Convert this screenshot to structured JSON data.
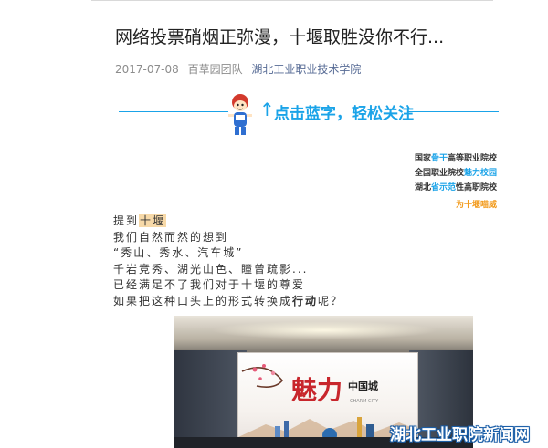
{
  "article": {
    "title": "网络投票硝烟正弥漫，十堰取胜没你不行...",
    "date": "2017-07-08",
    "author": "百草园团队",
    "account": "湖北工业职业技术学院"
  },
  "banner": {
    "cta_text": "点击蓝字，轻松关注",
    "arrow_glyph": "↑",
    "accent_color": "#1aa3e8"
  },
  "honors": {
    "line1": {
      "pre": "国家",
      "hl": "骨干",
      "post": "高等职业院校"
    },
    "line2": {
      "pre": "全国职业院校",
      "hl": "魅力校园",
      "post": ""
    },
    "line3": {
      "pre": "湖北",
      "hl": "省示范",
      "post": "性高职院校"
    },
    "slogan": "为十堰喵威"
  },
  "body": {
    "line1_pre": "提到",
    "line1_hl": "十堰",
    "line2": "我们自然而然的想到",
    "line3": "“秀山、秀水、汽车城”",
    "line4": "千岩竞秀、湖光山色、瞳曾疏影...",
    "line5": "已经满足不了我们对于十堰的尊爱",
    "line6_pre": "如果把这种口头上的形式转换成",
    "line6_bold": "行动",
    "line6_post": "呢？"
  },
  "photo": {
    "screen_logo_main": "魅力",
    "screen_logo_sub": "中国城",
    "screen_logo_tag": "CHARM CITY"
  },
  "watermark": "湖北工业职院新闻网"
}
